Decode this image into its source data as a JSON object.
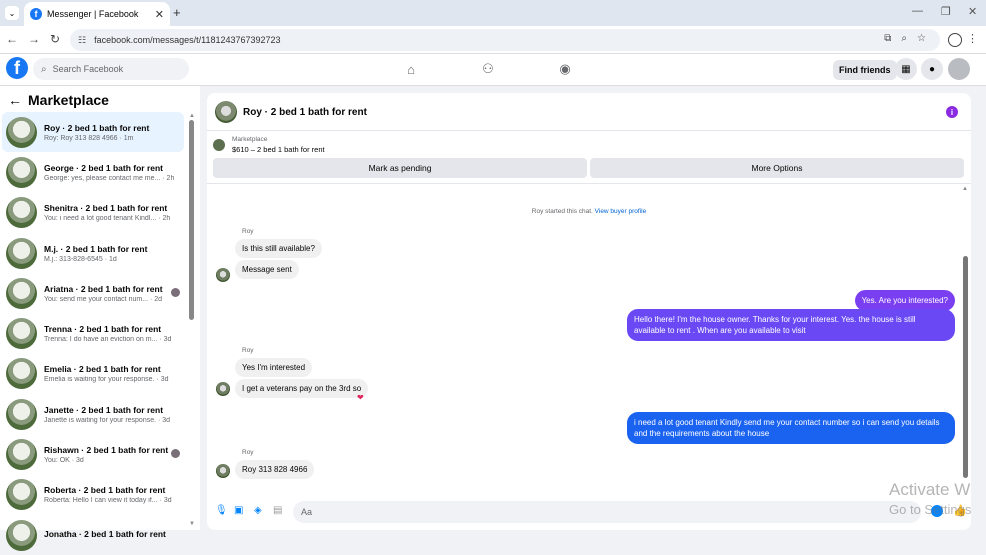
{
  "browser": {
    "tab_title": "Messenger | Facebook",
    "url": "facebook.com/messages/t/1181243767392723",
    "new_tab": "+",
    "tab_close": "✕"
  },
  "fbnav": {
    "logo": "f",
    "search_placeholder": "Search Facebook",
    "find_friends": "Find friends"
  },
  "sidebar": {
    "title": "Marketplace",
    "conversations": [
      {
        "name": "Roy · 2 bed 1 bath for rent",
        "preview": "Roy: Roy 313 828 4966 · 1m",
        "active": true
      },
      {
        "name": "George · 2 bed 1 bath for rent",
        "preview": "George: yes, please contact me me... · 2h"
      },
      {
        "name": "Shenitra · 2 bed 1 bath for rent",
        "preview": "You: i need a lot good tenant Kindl... · 2h"
      },
      {
        "name": "M.j. · 2 bed 1 bath for rent",
        "preview": "M.j.: 313-828-6545 · 1d"
      },
      {
        "name": "Ariatna · 2 bed 1 bath for rent",
        "preview": "You: send me your contact num... · 2d"
      },
      {
        "name": "Trenna · 2 bed 1 bath for rent",
        "preview": "Trenna: I do have an eviction on m... · 3d"
      },
      {
        "name": "Emelia · 2 bed 1 bath for rent",
        "preview": "Emelia is waiting for your response. · 3d"
      },
      {
        "name": "Janette · 2 bed 1 bath for rent",
        "preview": "Janette is waiting for your response. · 3d"
      },
      {
        "name": "Rishawn · 2 bed 1 bath for rent",
        "preview": "You: OK · 3d"
      },
      {
        "name": "Roberta · 2 bed 1 bath for rent",
        "preview": "Roberta: Hello I can view it today if... · 3d"
      },
      {
        "name": "Jonatha · 2 bed 1 bath for rent",
        "preview": ""
      }
    ]
  },
  "chat": {
    "title": "Roy · 2 bed 1 bath for rent",
    "marketplace_label": "Marketplace",
    "listing_price": "$610 – 2 bed 1 bath for rent",
    "mark_pending": "Mark as pending",
    "more_options": "More Options",
    "system_text": "Roy started this chat.",
    "system_link": "View buyer profile",
    "sender_name": "Roy",
    "messages": {
      "m1": "Is this still available?",
      "m2": "Message sent",
      "m3": "Yes. Are you interested?",
      "m4": "Hello there! I'm the house owner. Thanks for your interest. Yes. the house is still available to rent . When are you available to visit",
      "m5": "Yes I'm interested",
      "m6": "I get a veterans pay on the 3rd so",
      "m7": "i need a lot good tenant Kindly send me your contact number so i can send you details and the requirements about the house",
      "m8": "Roy 313 828 4966"
    },
    "composer_placeholder": "Aa",
    "colors": {
      "out_purple": "#7b3ff2",
      "out_blue": "#1a62f0"
    }
  },
  "watermark": {
    "line1": "Activate W",
    "line2": "Go to Settings"
  }
}
